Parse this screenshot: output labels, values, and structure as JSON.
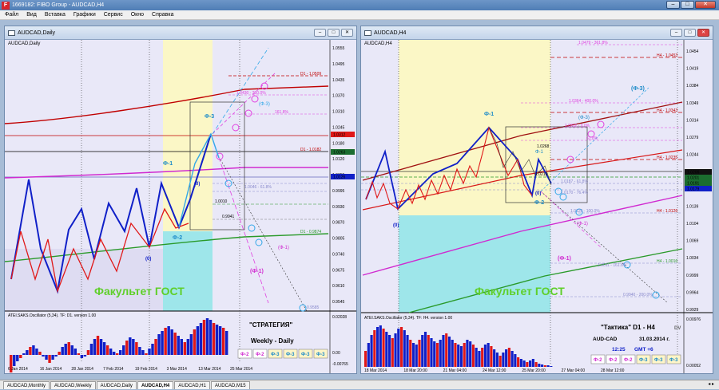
{
  "app": {
    "title": "1669182: FIBO Group - AUDCAD,H4",
    "icon": "F"
  },
  "menu": [
    "Файл",
    "Вид",
    "Вставка",
    "Графики",
    "Сервис",
    "Окно",
    "Справка"
  ],
  "left_chart": {
    "title": "AUDCAD,Daily",
    "symbol_label": "AUDCAD,Daily",
    "watermark": "Факультет ГОСТ",
    "osc_label": "ATEI.SAKS.Oscillator (5,34). TF: D1. version 1.00",
    "osc_title": "\"СТРАТЕГИЯ\"",
    "osc_subtitle": "Weekly - Daily",
    "phase_buttons": [
      "Ф-2",
      "Ф-2",
      "Ф-3",
      "Ф-3",
      "Ф-3",
      "Ф-3"
    ],
    "price_ticks": [
      "1.0555",
      "1.0495",
      "1.0435",
      "1.0370",
      "1.0310",
      "1.0245",
      "1.0180",
      "1.0120",
      "1.0055",
      "0.9995",
      "0.9930",
      "0.9870",
      "0.9805",
      "0.9740",
      "0.9675",
      "0.9610",
      "0.9545"
    ],
    "osc_ticks": [
      "0.02028",
      "0.00",
      "-0.00765"
    ],
    "date_ticks": [
      "6 Jan 2014",
      "16 Jan 2014",
      "28 Jan 2014",
      "7 Feb 2014",
      "19 Feb 2014",
      "3 Mar 2014",
      "13 Mar 2014",
      "25 Mar 2014"
    ],
    "price_badges": [
      "1.0312",
      "1.0263",
      "1.0126"
    ],
    "levels": [
      {
        "text": "D1 - 1.0509",
        "color": "#c00000"
      },
      {
        "text": "1.0430 - 250.0%",
        "color": "#e040e0"
      },
      {
        "text": "161.8%",
        "color": "#e040e0"
      },
      {
        "text": "D1 - 1.0182",
        "color": "#c00000"
      },
      {
        "text": "1.0046 - 61.8%",
        "color": "#8888cc"
      },
      {
        "text": "1.0010",
        "color": "#000"
      },
      {
        "text": "0.9941",
        "color": "#000"
      },
      {
        "text": "D1 - 0.9874",
        "color": "#2a9a2a"
      },
      {
        "text": "0.9585",
        "color": "#8888cc"
      }
    ],
    "wave_labels": [
      "Ф-3",
      "Ф-1",
      "Ф-2",
      "(0)",
      "(0)",
      "(Ф-1)",
      "(Ф-3)",
      "(Ф-1)",
      "Ф-1",
      "Ф-3"
    ]
  },
  "right_chart": {
    "title": "AUDCAD,H4",
    "symbol_label": "AUDCAD,H4",
    "watermark": "Факультет ГОСТ",
    "osc_label": "ATEI.SAKS.Oscillator (5,34). TF: H4. version 1.00",
    "osc_title": "\"Тактика\"  D1 - H4",
    "osc_pair": "AUD-CAD",
    "osc_date": "31.03.2014  г.",
    "osc_time": "12:25",
    "osc_gmt": "GMT +6",
    "osc_dv": "DV",
    "phase_buttons": [
      "Ф-2",
      "Ф-2",
      "Ф-2",
      "Ф-3",
      "Ф-3",
      "Ф-3"
    ],
    "price_ticks": [
      "1.0454",
      "1.0419",
      "1.0384",
      "1.0349",
      "1.0314",
      "1.0279",
      "1.0244",
      "1.0209",
      "1.0174",
      "1.0139",
      "1.0104",
      "1.0069",
      "1.0034",
      "0.9999",
      "0.9964",
      "0.9929"
    ],
    "osc_ticks": [
      "0.00976",
      "0.00052"
    ],
    "date_ticks": [
      "18 Mar 2014",
      "18 Mar 20:00",
      "21 Mar 04:00",
      "24 Mar 12:00",
      "25 Mar 20:00",
      "27 Mar 04:00",
      "28 Mar 12:00"
    ],
    "price_badges": [
      "1.0206",
      "1.0201",
      "1.0191",
      "1.0179"
    ],
    "levels": [
      {
        "text": "1.0479 - 361.8%",
        "color": "#e040e0"
      },
      {
        "text": "H4 - 1.0453",
        "color": "#c00000"
      },
      {
        "text": "1.0364 - 400.0%",
        "color": "#e040e0"
      },
      {
        "text": "H4 - 1.0343",
        "color": "#c00000"
      },
      {
        "text": "1.0312 - 0.0%",
        "color": "#e040e0"
      },
      {
        "text": "61.8%",
        "color": "#e040e0"
      },
      {
        "text": "1.0268",
        "color": "#000"
      },
      {
        "text": "H4 - 1.0235",
        "color": "#c00000"
      },
      {
        "text": "1.0219",
        "color": "#000"
      },
      {
        "text": "1.0187 - 61.8%",
        "color": "#8888cc"
      },
      {
        "text": "1.0170 - 76.4%",
        "color": "#8888cc"
      },
      {
        "text": "1.0126 - 100.0%",
        "color": "#8888cc"
      },
      {
        "text": "H4 - 1.0126",
        "color": "#c00000"
      },
      {
        "text": "H4 - 1.0016",
        "color": "#2a9a2a"
      },
      {
        "text": "1.0011 - 161.8%",
        "color": "#8888cc"
      },
      {
        "text": "0.9940 - 200.0%",
        "color": "#8888cc"
      }
    ],
    "wave_labels": [
      "Ф-1",
      "(Ф-3)",
      "(Ф-3)",
      "Ф-1",
      "(0)",
      "Ф-2",
      "(0)",
      "(Ф-1)",
      "(Ф-1)"
    ]
  },
  "tabs": [
    "AUDCAD,Monthly",
    "AUDCAD,Weekly",
    "AUDCAD,Daily",
    "AUDCAD,H4",
    "AUDCAD,H1",
    "AUDCAD,M15"
  ],
  "active_tab": "AUDCAD,H4",
  "colors": {
    "chart_bg": "#e9e8f8",
    "bull": "#1020c8",
    "bear": "#e01818",
    "yellow_zone": "#fbf7c6",
    "cyan_zone": "#9ee6ea",
    "watermark": "#5fcf2a"
  }
}
